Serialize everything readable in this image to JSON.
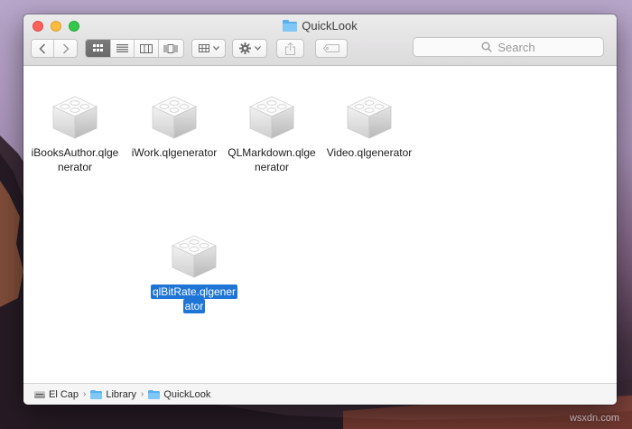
{
  "window": {
    "title": "QuickLook"
  },
  "toolbar": {
    "back_glyph": "‹",
    "forward_glyph": "›",
    "view_modes": [
      "icon-view",
      "list-view",
      "column-view",
      "cover-flow-view"
    ],
    "active_view": "icon-view",
    "search_placeholder": "Search"
  },
  "files": [
    {
      "line1": "iBooksAuthor.qlge",
      "line2": "nerator",
      "selected": false
    },
    {
      "line1": "iWork.qlgenerator",
      "line2": "",
      "selected": false
    },
    {
      "line1": "QLMarkdown.qlge",
      "line2": "nerator",
      "selected": false
    },
    {
      "line1": "Video.qlgenerator",
      "line2": "",
      "selected": false
    },
    {
      "line1": "qlBitRate.qlgener",
      "line2": "ator",
      "selected": true
    }
  ],
  "pathbar": {
    "disk": "El Cap",
    "folder1": "Library",
    "folder2": "QuickLook",
    "separator": "›"
  },
  "colors": {
    "selection": "#1e75d5",
    "folder": "#5ab0ec",
    "close": "#fc605c",
    "minimize": "#fdbc40",
    "zoom": "#34c84a"
  },
  "desktop": {
    "watermark": "wsxdn.com"
  }
}
